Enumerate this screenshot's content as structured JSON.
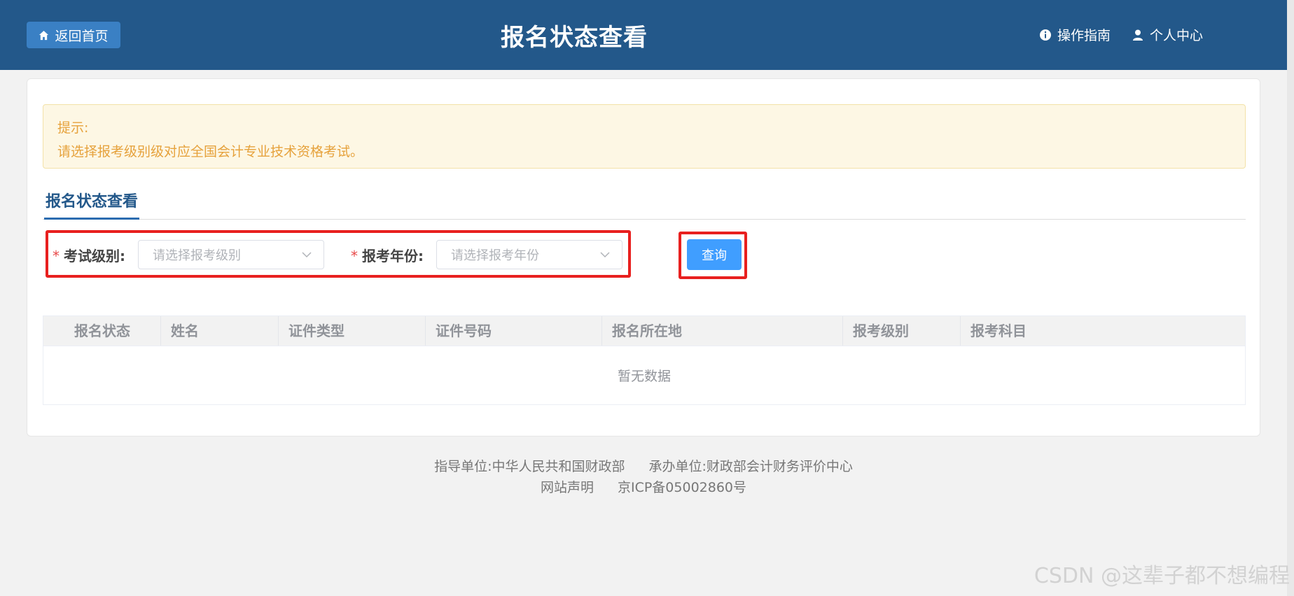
{
  "header": {
    "home_label": "返回首页",
    "title": "报名状态查看",
    "guide_label": "操作指南",
    "personal_label": "个人中心"
  },
  "notice": {
    "title": "提示:",
    "text": "请选择报考级别级对应全国会计专业技术资格考试。"
  },
  "section": {
    "tab_label": "报名状态查看"
  },
  "filters": {
    "level": {
      "required_mark": "*",
      "label": "考试级别:",
      "placeholder": "请选择报考级别"
    },
    "year": {
      "required_mark": "*",
      "label": "报考年份:",
      "placeholder": "请选择报考年份"
    },
    "query_label": "查询"
  },
  "table": {
    "columns": [
      "报名状态",
      "姓名",
      "证件类型",
      "证件号码",
      "报名所在地",
      "报考级别",
      "报考科目"
    ],
    "empty_text": "暂无数据"
  },
  "footer": {
    "guide_unit": "指导单位:中华人民共和国财政部",
    "host_unit": "承办单位:财政部会计财务评价中心",
    "statement": "网站声明",
    "icp": "京ICP备05002860号"
  },
  "watermark": "CSDN @这辈子都不想编程",
  "colors": {
    "header_bg": "#23588a",
    "primary": "#409eff",
    "warning": "#e6a23c",
    "highlight": "#e8201f"
  }
}
